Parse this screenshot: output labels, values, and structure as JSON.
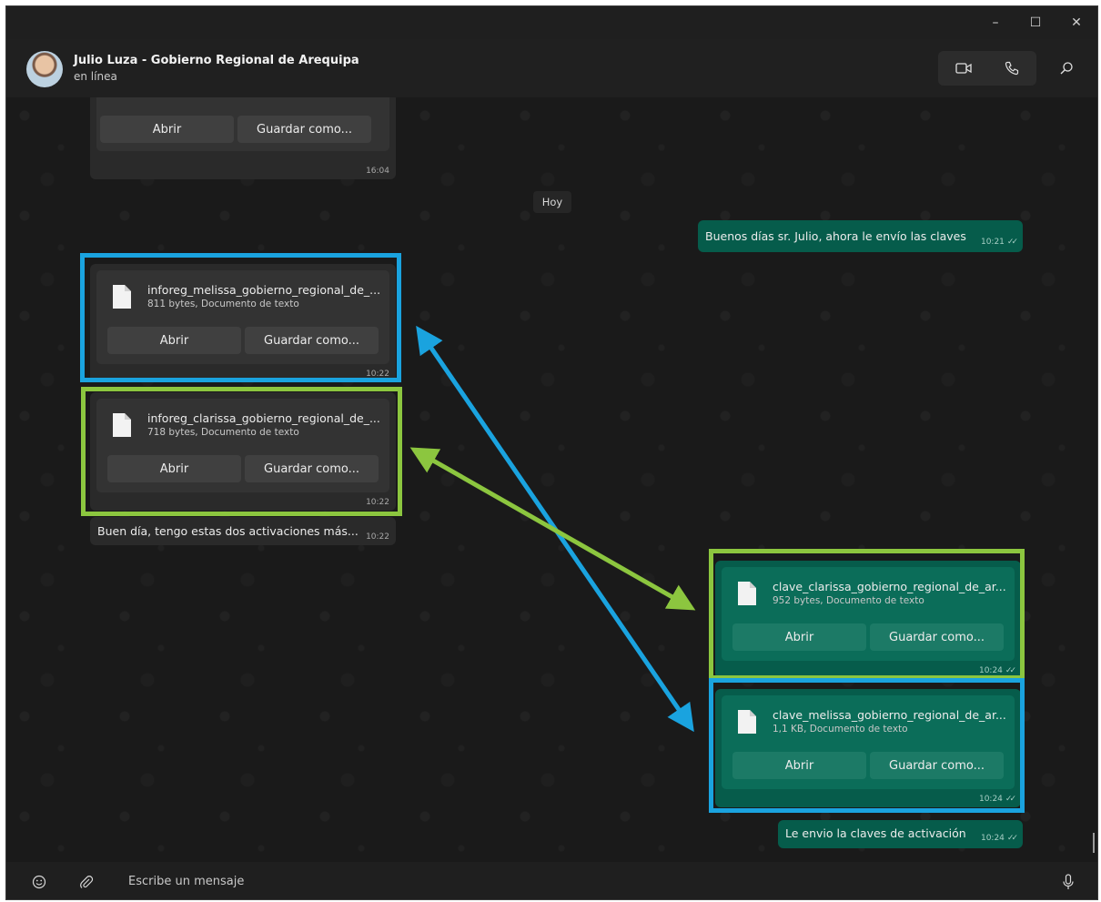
{
  "window": {
    "minimize_glyph": "–",
    "maximize_glyph": "☐",
    "close_glyph": "✕"
  },
  "header": {
    "contact_name": "Julio Luza - Gobierno Regional de Arequipa",
    "status": "en línea",
    "icons": [
      "video-call-icon",
      "voice-call-icon",
      "search-icon"
    ]
  },
  "chat": {
    "day_badge": "Hoy",
    "earlier_file": {
      "open_label": "Abrir",
      "save_label": "Guardar como...",
      "time": "16:04"
    },
    "greeting": {
      "text": "Buenos días sr. Julio, ahora le envío las claves",
      "time": "10:21"
    },
    "incoming_files": [
      {
        "name": "inforeg_melissa_gobierno_regional_de_...",
        "meta": "811 bytes, Documento de texto",
        "open_label": "Abrir",
        "save_label": "Guardar como...",
        "time": "10:22",
        "highlight": "blue"
      },
      {
        "name": "inforeg_clarissa_gobierno_regional_de_...",
        "meta": "718 bytes, Documento de texto",
        "open_label": "Abrir",
        "save_label": "Guardar como...",
        "time": "10:22",
        "highlight": "green"
      }
    ],
    "incoming_text": {
      "text": "Buen día, tengo estas dos activaciones más...",
      "time": "10:22"
    },
    "outgoing_files": [
      {
        "name": "clave_clarissa_gobierno_regional_de_ar...",
        "meta": "952 bytes, Documento de texto",
        "open_label": "Abrir",
        "save_label": "Guardar como...",
        "time": "10:24",
        "highlight": "green"
      },
      {
        "name": "clave_melissa_gobierno_regional_de_ar...",
        "meta": "1,1 KB, Documento de texto",
        "open_label": "Abrir",
        "save_label": "Guardar como...",
        "time": "10:24",
        "highlight": "blue"
      }
    ],
    "outgoing_text": {
      "text": "Le envio la claves de activación",
      "time": "10:24"
    },
    "read_ticks": "✓✓"
  },
  "composer": {
    "placeholder": "Escribe un mensaje",
    "icons": [
      "emoji-icon",
      "attach-icon",
      "microphone-icon"
    ]
  },
  "annotations": {
    "blue": "#1aa3df",
    "green": "#8cc63f"
  }
}
